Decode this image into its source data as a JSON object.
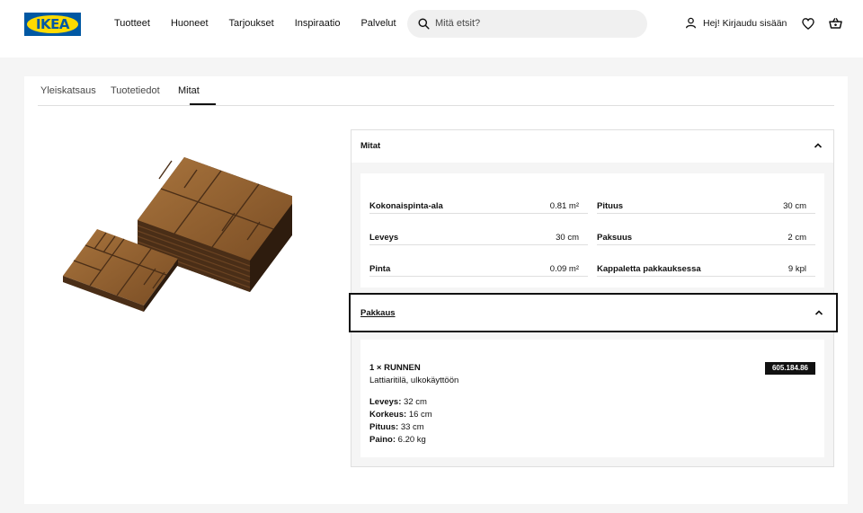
{
  "header": {
    "logo_text": "IKEA",
    "nav": [
      "Tuotteet",
      "Huoneet",
      "Tarjoukset",
      "Inspiraatio",
      "Palvelut"
    ],
    "search_placeholder": "Mitä etsit?",
    "login_label": "Hej! Kirjaudu sisään",
    "icons": {
      "search": "search-icon",
      "user": "user-icon",
      "favourites": "heart-icon",
      "cart": "cart-icon"
    }
  },
  "tabs": [
    {
      "label": "Yleiskatsaus",
      "active": false
    },
    {
      "label": "Tuotetiedot",
      "active": false
    },
    {
      "label": "Mitat",
      "active": true
    }
  ],
  "product_image": {
    "name": "product-image"
  },
  "mitat": {
    "title": "Mitat",
    "expanded": true,
    "rows": [
      {
        "label": "Kokonaispinta-ala",
        "value": "0.81 m²"
      },
      {
        "label": "Leveys",
        "value": "30 cm"
      },
      {
        "label": "Pinta",
        "value": "0.09 m²"
      },
      {
        "label": "Pituus",
        "value": "30 cm"
      },
      {
        "label": "Paksuus",
        "value": "2 cm"
      },
      {
        "label": "Kappaletta pakkauksessa",
        "value": "9 kpl"
      }
    ]
  },
  "pakkaus": {
    "title": "Pakkaus",
    "expanded": true,
    "item": {
      "name": "1 × RUNNEN",
      "description": "Lattiaritilä, ulkokäyttöön",
      "article_number": "605.184.86",
      "specs": [
        {
          "label": "Leveys:",
          "value": "32 cm"
        },
        {
          "label": "Korkeus:",
          "value": "16 cm"
        },
        {
          "label": "Pituus:",
          "value": "33 cm"
        },
        {
          "label": "Paino:",
          "value": "6.20 kg"
        }
      ]
    }
  },
  "colors": {
    "ikea_blue": "#0058a3",
    "ikea_yellow": "#ffdb00",
    "wood": "#8a5a2b"
  }
}
